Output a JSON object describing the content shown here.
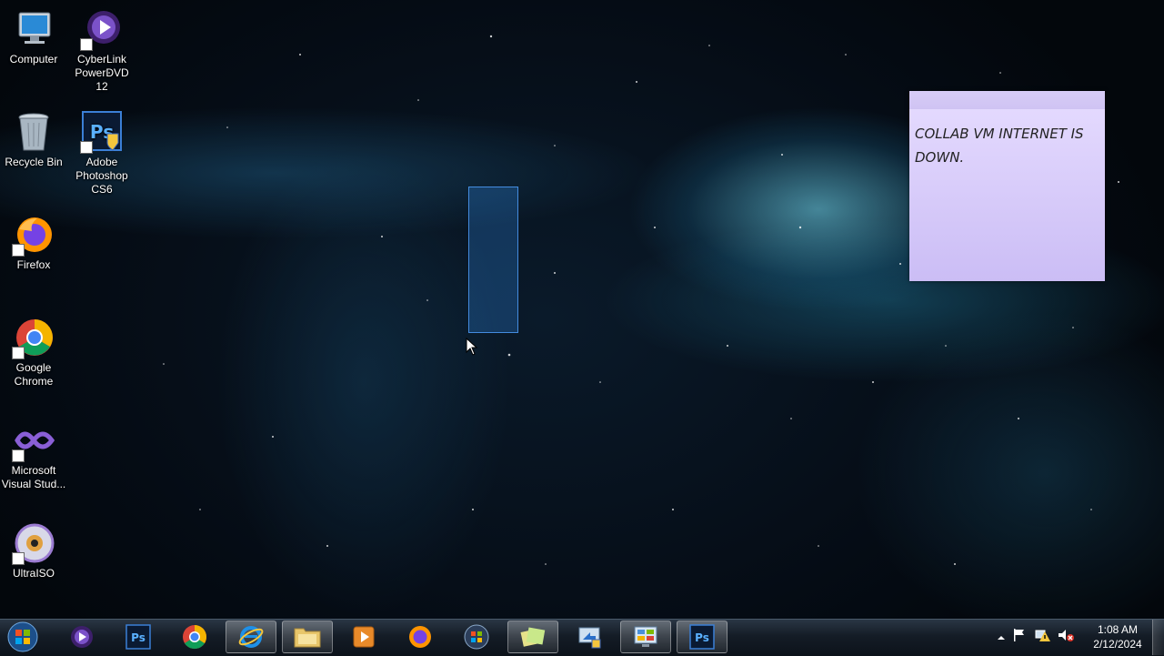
{
  "desktop": {
    "icons": [
      {
        "label": "Computer",
        "icon": "computer-icon"
      },
      {
        "label": "CyberLink PowerDVD 12",
        "icon": "powerdvd-icon"
      },
      {
        "label": "Recycle Bin",
        "icon": "recycle-bin-icon"
      },
      {
        "label": "Adobe Photoshop CS6",
        "icon": "photoshop-icon"
      },
      {
        "label": "Firefox",
        "icon": "firefox-icon"
      },
      {
        "label": "Google Chrome",
        "icon": "chrome-icon"
      },
      {
        "label": "Microsoft Visual Stud...",
        "icon": "visual-studio-icon"
      },
      {
        "label": "UltraISO",
        "icon": "ultraiso-icon"
      }
    ]
  },
  "sticky_note": {
    "text": "COLLAB VM INTERNET IS DOWN.",
    "color": "#d9cffa"
  },
  "taskbar": {
    "pinned": [
      {
        "name": "powerdvd",
        "icon": "powerdvd-icon",
        "active": false
      },
      {
        "name": "photoshop-shield",
        "icon": "photoshop-icon",
        "active": false
      },
      {
        "name": "chrome",
        "icon": "chrome-icon",
        "active": false
      },
      {
        "name": "internet-explorer",
        "icon": "internet-explorer-icon",
        "active": true
      },
      {
        "name": "file-explorer",
        "icon": "folder-icon",
        "active": true
      },
      {
        "name": "media-player",
        "icon": "media-player-icon",
        "active": false
      },
      {
        "name": "firefox",
        "icon": "firefox-icon",
        "active": false
      },
      {
        "name": "windows-setup",
        "icon": "windows-setup-icon",
        "active": false
      },
      {
        "name": "sticky-notes",
        "icon": "sticky-notes-icon",
        "active": true
      },
      {
        "name": "remote-desktop",
        "icon": "remote-desktop-icon",
        "active": false
      },
      {
        "name": "control-panel",
        "icon": "control-panel-icon",
        "active": true
      },
      {
        "name": "photoshop",
        "icon": "photoshop-icon",
        "active": true
      }
    ],
    "clock": {
      "time": "1:08 AM",
      "date": "2/12/2024"
    },
    "tray_icons": [
      "show-hidden-icons-arrow",
      "action-center-flag-icon",
      "network-warning-icon",
      "volume-muted-icon"
    ]
  }
}
